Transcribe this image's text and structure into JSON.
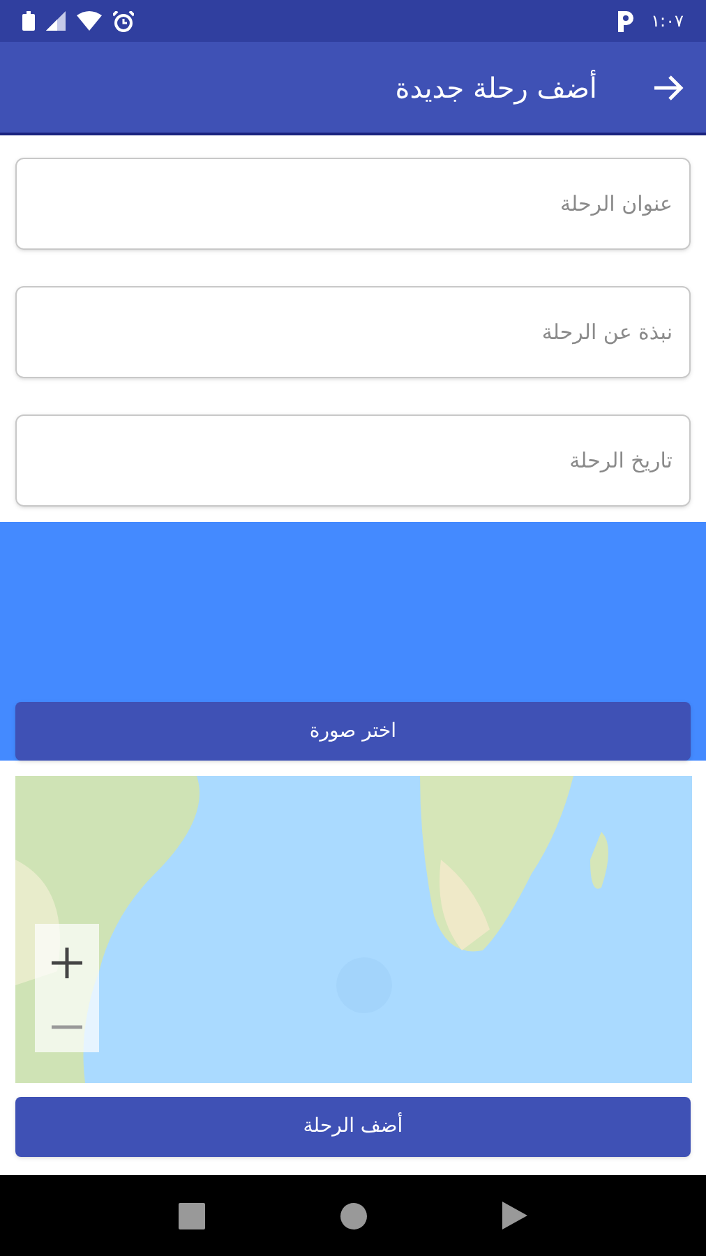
{
  "status_bar": {
    "time": "١:٠٧"
  },
  "app_bar": {
    "title": "أضف رحلة جديدة"
  },
  "fields": [
    {
      "placeholder": "عنوان الرحلة"
    },
    {
      "placeholder": "نبذة عن الرحلة"
    },
    {
      "placeholder": "تاريخ الرحلة"
    }
  ],
  "image_area": {
    "button": "اختر صورة"
  },
  "submit_button": "أضف الرحلة"
}
